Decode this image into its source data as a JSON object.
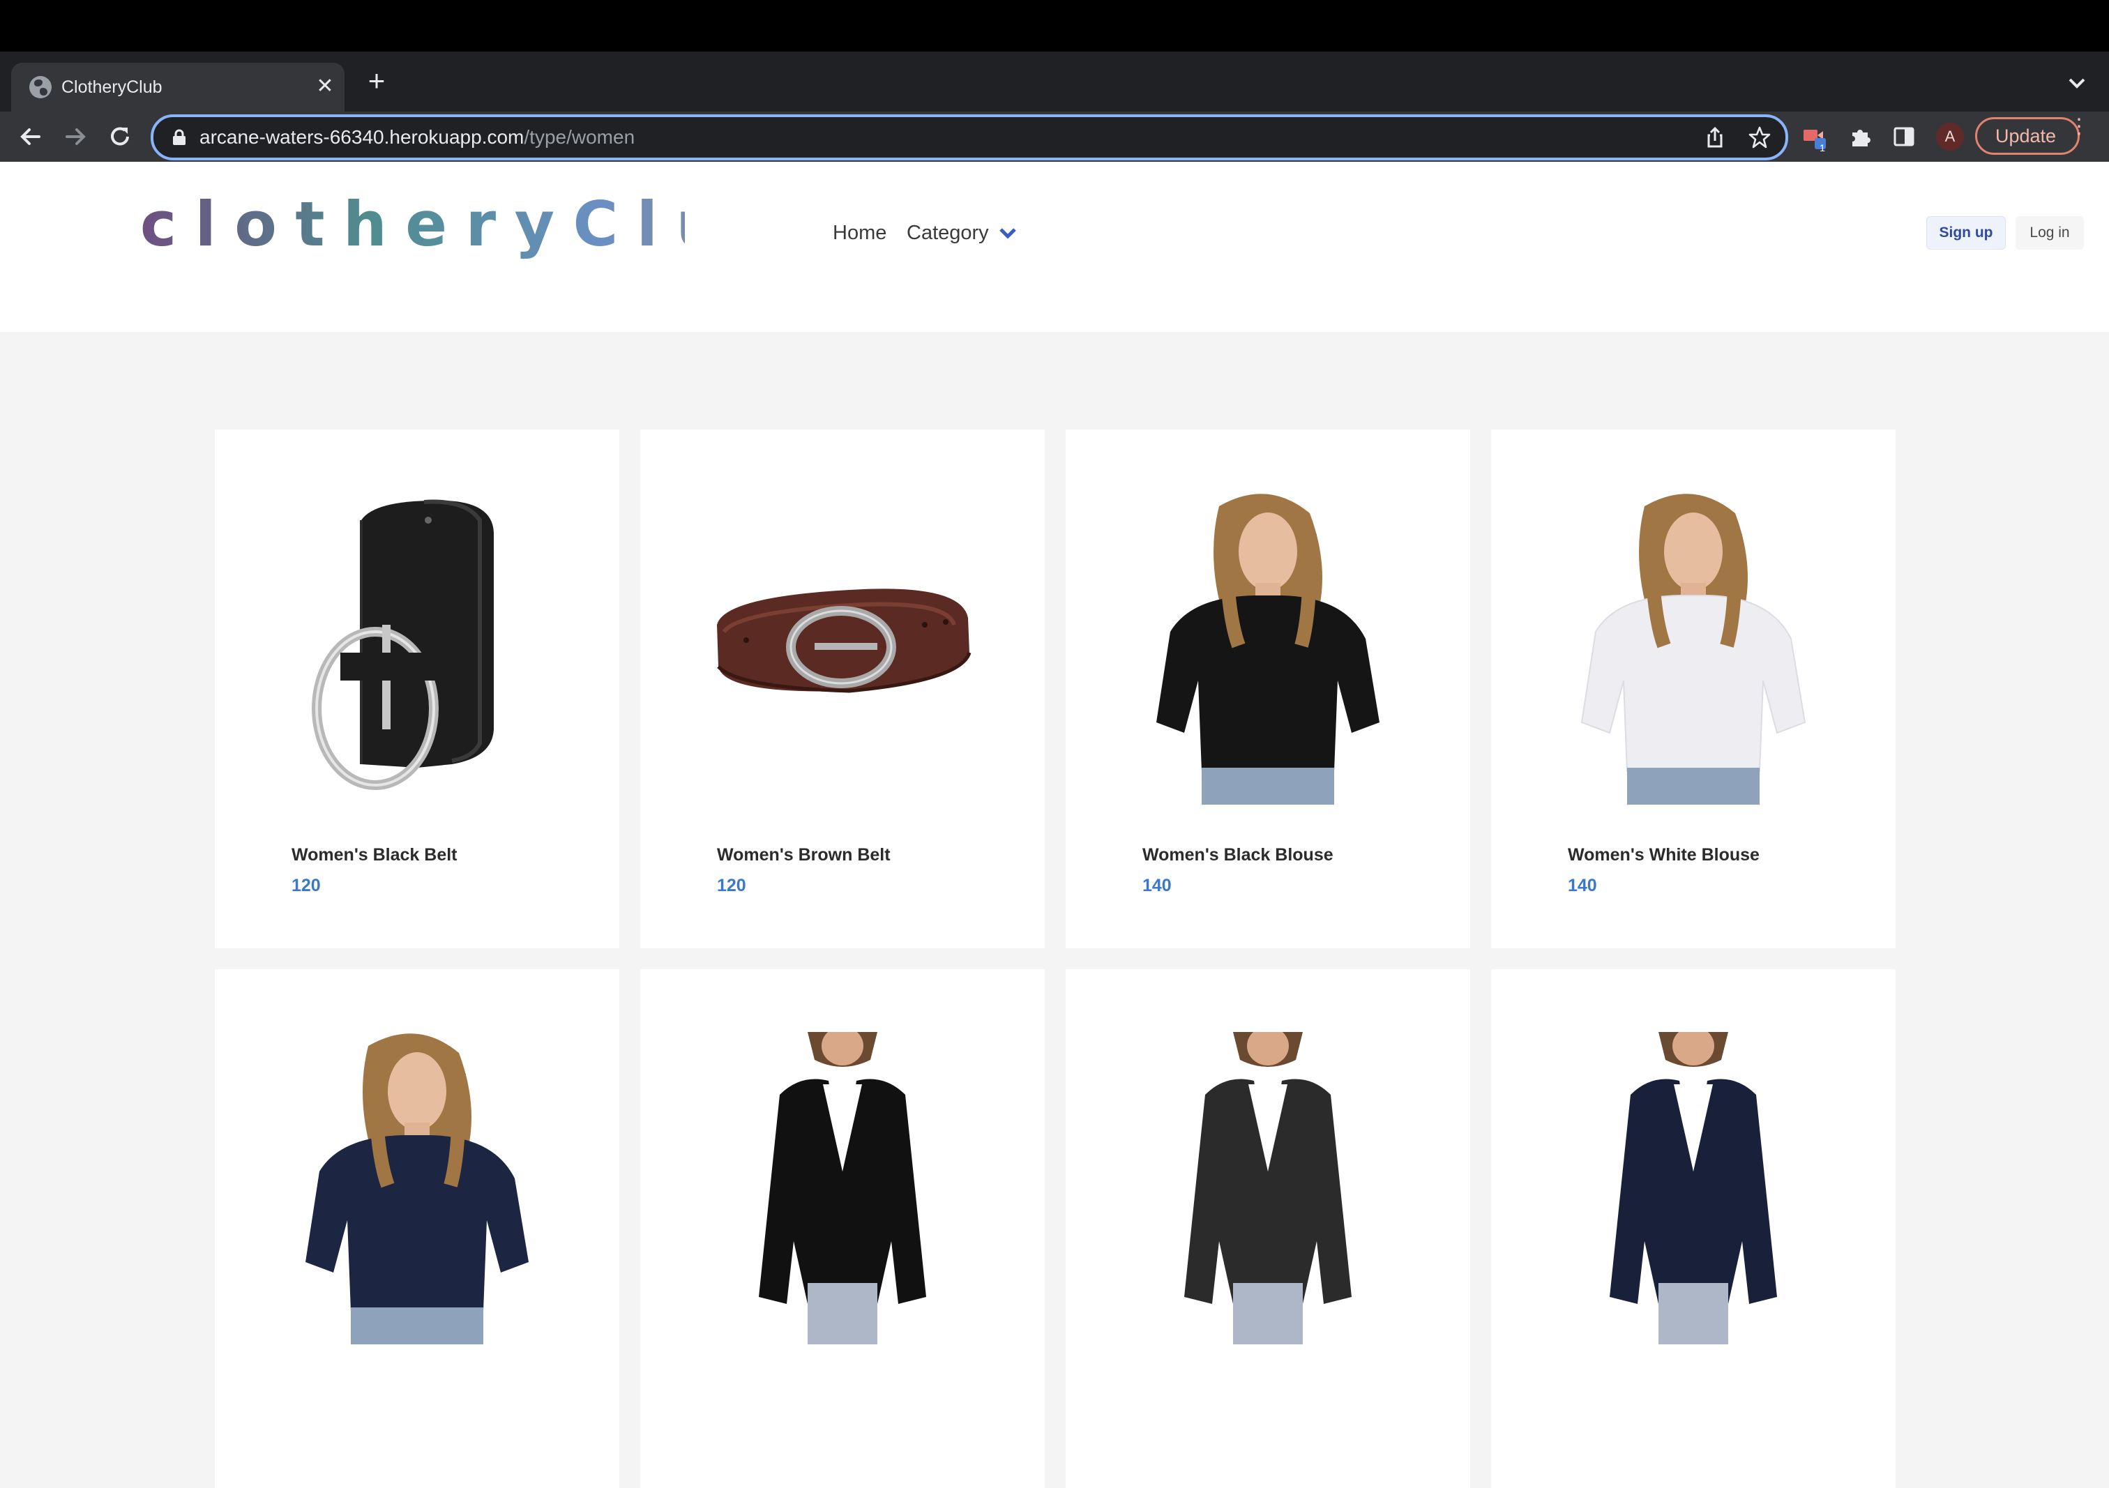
{
  "browser": {
    "tab_title": "ClotheryClub",
    "url_host": "arcane-waters-66340.herokuapp.com",
    "url_path": "/type/women",
    "avatar_letter": "A",
    "update_label": "Update",
    "extension_badge": "1"
  },
  "site": {
    "logo_text": "clotheryClub",
    "nav": {
      "home": "Home",
      "category": "Category"
    },
    "auth": {
      "signup": "Sign up",
      "login": "Log in"
    },
    "colors": {
      "price": "#3a79c9",
      "background": "#f4f4f4"
    }
  },
  "products": [
    {
      "name": "Women's Black Belt",
      "price": "120",
      "image": "black-belt"
    },
    {
      "name": "Women's Brown Belt",
      "price": "120",
      "image": "brown-belt"
    },
    {
      "name": "Women's Black Blouse",
      "price": "140",
      "image": "black-blouse"
    },
    {
      "name": "Women's White Blouse",
      "price": "140",
      "image": "white-blouse"
    },
    {
      "name": "",
      "price": "",
      "image": "navy-blouse"
    },
    {
      "name": "",
      "price": "",
      "image": "black-blazer"
    },
    {
      "name": "",
      "price": "",
      "image": "charcoal-blazer"
    },
    {
      "name": "",
      "price": "",
      "image": "navy-blazer"
    }
  ]
}
